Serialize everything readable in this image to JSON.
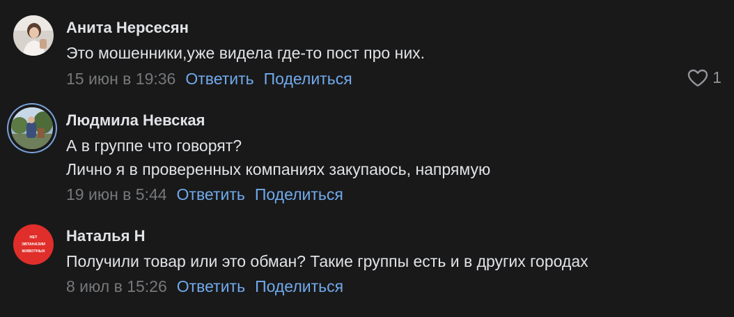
{
  "colors": {
    "background": "#19191a",
    "text": "#e1e3e6",
    "muted": "#76787a",
    "link": "#71aaeb",
    "like_icon": "#939598"
  },
  "comments": [
    {
      "author": "Анита Нерсесян",
      "avatar_icon": "photo-avatar",
      "lines": [
        "Это мошенники,уже видела где-то пост про них."
      ],
      "date": "15 июн в 19:36",
      "reply_label": "Ответить",
      "share_label": "Поделиться",
      "likes": "1",
      "like_icon": "heart-icon"
    },
    {
      "author": "Людмила Невская",
      "avatar_icon": "photo-avatar",
      "lines": [
        "А в группе что говорят?",
        "Лично я в проверенных компаниях закупаюсь, напрямую"
      ],
      "date": "19 июн в 5:44",
      "reply_label": "Ответить",
      "share_label": "Поделиться"
    },
    {
      "author": "Наталья Н",
      "avatar_icon": "red-badge-avatar",
      "avatar_text": [
        "НЕТ",
        "ЭВТАНАЗИИ",
        "ЖИВОТНЫХ"
      ],
      "lines": [
        "Получили товар или это обман? Такие группы есть и в других городах"
      ],
      "date": "8 июл в 15:26",
      "reply_label": "Ответить",
      "share_label": "Поделиться"
    }
  ]
}
